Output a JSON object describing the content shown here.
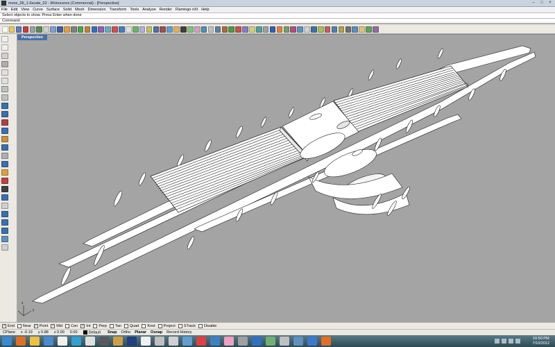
{
  "window": {
    "title": "move_06_1-6scale_02 - Rhinoceros (Commercial) - [Perspective]",
    "controls": [
      "–",
      "□",
      "×"
    ]
  },
  "menu": [
    "File",
    "Edit",
    "View",
    "Curve",
    "Surface",
    "Solid",
    "Mesh",
    "Dimension",
    "Transform",
    "Tools",
    "Analyze",
    "Render",
    "Flamingo nXt",
    "Help"
  ],
  "command_history": "Select objects to show. Press Enter when done",
  "command_prompt": "Command:",
  "command_value": "",
  "viewport": {
    "label": "Perspective",
    "axis_labels": {
      "z": "z",
      "y": "y",
      "x": "x"
    }
  },
  "osnaps": [
    {
      "label": "End",
      "checked": true
    },
    {
      "label": "Near",
      "checked": false
    },
    {
      "label": "Point",
      "checked": true
    },
    {
      "label": "Mid",
      "checked": true
    },
    {
      "label": "Cen",
      "checked": false
    },
    {
      "label": "Int",
      "checked": true
    },
    {
      "label": "Perp",
      "checked": false
    },
    {
      "label": "Tan",
      "checked": false
    },
    {
      "label": "Quad",
      "checked": false
    },
    {
      "label": "Knot",
      "checked": false
    },
    {
      "label": "Project",
      "checked": false
    },
    {
      "label": "STrack",
      "checked": false
    },
    {
      "label": "Disable",
      "checked": false
    }
  ],
  "status": {
    "cplane": "CPlane",
    "x": "x -0.19",
    "y": "y 0.88",
    "z": "z 0.00",
    "units": "0.00",
    "layer": "Default",
    "toggles": [
      {
        "label": "Snap",
        "on": true
      },
      {
        "label": "Ortho",
        "on": false
      },
      {
        "label": "Planar",
        "on": true
      },
      {
        "label": "Osnap",
        "on": true
      },
      {
        "label": "Record History",
        "on": false
      }
    ]
  },
  "clock": {
    "time": "10:50 PM",
    "date": "7/10/2012"
  },
  "colors": {
    "viewport_bg": "#a4a4a4",
    "model_fill": "#ffffff",
    "model_edge": "#1a1a1a",
    "tab_active": "#4a6fa8"
  }
}
